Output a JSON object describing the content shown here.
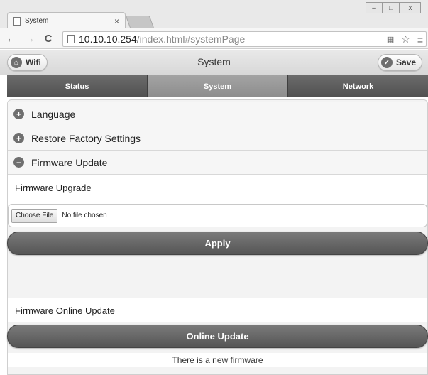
{
  "browser": {
    "tab_title": "System",
    "tab_close": "×",
    "url_host": "10.10.10.254",
    "url_path": "/index.html#systemPage",
    "window_controls": [
      "–",
      "□",
      "x"
    ]
  },
  "header": {
    "title": "System",
    "left_button": "Wifi",
    "right_button": "Save"
  },
  "navbar": {
    "tabs": [
      "Status",
      "System",
      "Network"
    ],
    "active": "System"
  },
  "accordion": {
    "language": "Language",
    "restore": "Restore Factory Settings",
    "firmware": "Firmware Update"
  },
  "firmware_upgrade": {
    "title": "Firmware Upgrade",
    "choose_file": "Choose File",
    "no_file": "No file chosen",
    "apply": "Apply"
  },
  "online_update": {
    "title": "Firmware Online Update",
    "button": "Online Update",
    "status": "There is a new firmware"
  },
  "colors": {
    "nav_active": "#979797",
    "nav_bg": "#5c5c5c",
    "button_bg": "#666666"
  }
}
